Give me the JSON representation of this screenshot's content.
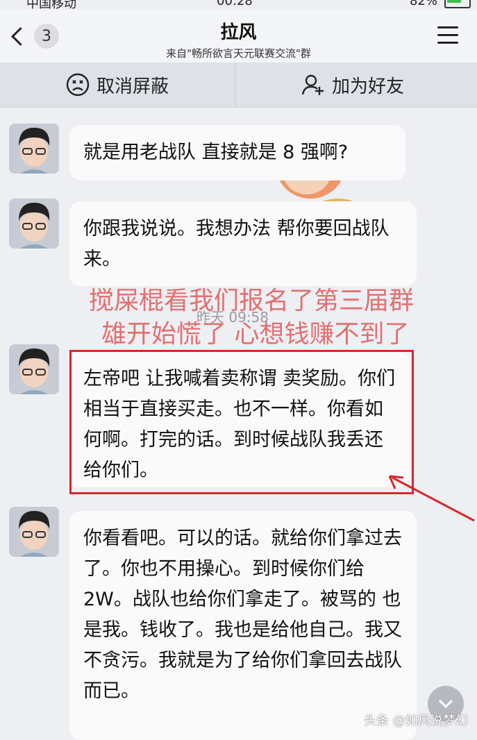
{
  "status_bar": {
    "carrier": "中国移动",
    "time": "00:28",
    "battery": "82%"
  },
  "nav": {
    "back_count": "3",
    "title": "拉风",
    "subtitle": "来自\"畅所欲言天元联赛交流\"群"
  },
  "actions": {
    "unblock_label": "取消屏蔽",
    "add_friend_label": "加为好友"
  },
  "messages": [
    {
      "text": "就是用老战队 直接就是 8 强啊?"
    },
    {
      "text": "你跟我说说。我想办法 帮你要回战队来。"
    },
    {
      "text": "左帝吧 让我喊着卖称谓 卖奖励。你们相当于直接买走。也不一样。你看如何啊。打完的话。到时候战队我丢还给你们。"
    },
    {
      "text": "你看看吧。可以的话。就给你们拿过去了。你也不用操心。到时候你们给 2W。战队也给你们拿走了。被骂的 也是我。钱收了。我也是给他自己。我又不贪污。我就是为了给你们拿回去战队而已。"
    }
  ],
  "timestamp": "昨天 09:58",
  "annotation": {
    "line1": "搅屎棍看我们报名了第三届群",
    "line2": "雄开始慌了 心想钱赚不到了"
  },
  "footer_watermark": "头条 @如风说梦幻",
  "colors": {
    "highlight": "#d8262a",
    "annotation_text": "#e05a5a"
  }
}
